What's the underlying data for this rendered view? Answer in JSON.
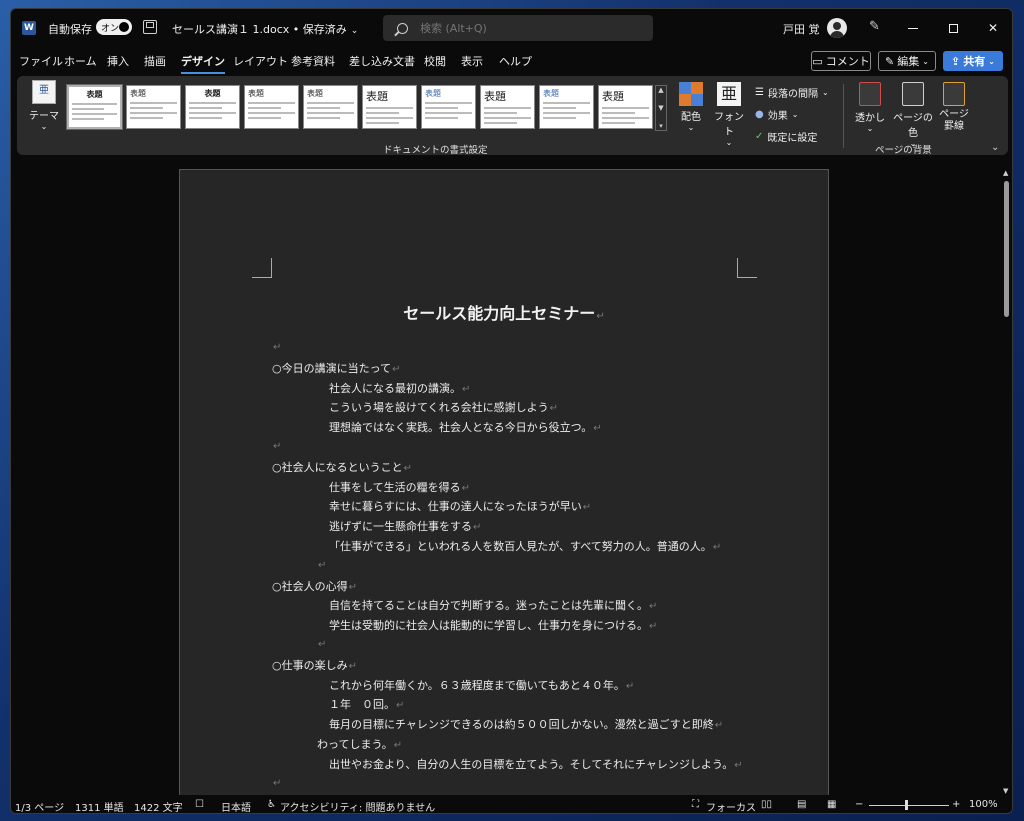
{
  "titlebar": {
    "app_letter": "W",
    "autosave_label": "自動保存",
    "toggle_label": "オン",
    "document_title": "セールス講演１ 1.docx • 保存済み",
    "search_placeholder": "検索 (Alt+Q)",
    "user_name": "戸田 覚"
  },
  "menu": {
    "tabs": [
      "ファイル",
      "ホーム",
      "挿入",
      "描画",
      "デザイン",
      "レイアウト",
      "参考資料",
      "差し込み文書",
      "校閲",
      "表示",
      "ヘルプ"
    ],
    "active_tab": "デザイン",
    "comment_label": "コメント",
    "edit_label": "編集",
    "share_label": "共有"
  },
  "ribbon": {
    "theme_label": "テーマ",
    "style_gallery": [
      {
        "heading": "表題",
        "variant": "center"
      },
      {
        "heading": "表題",
        "variant": "left"
      },
      {
        "heading": "表題",
        "variant": "center"
      },
      {
        "heading": "表題",
        "variant": "left"
      },
      {
        "heading": "表題",
        "variant": "left"
      },
      {
        "heading": "表題",
        "variant": "big"
      },
      {
        "heading": "表題",
        "variant": "blue"
      },
      {
        "heading": "表題",
        "variant": "big"
      },
      {
        "heading": "表題",
        "variant": "blue"
      },
      {
        "heading": "表題",
        "variant": "big"
      }
    ],
    "colors_label": "配色",
    "fonts_label": "フォント",
    "fonts_icon_glyph": "亜",
    "paragraph_spacing_label": "段落の間隔",
    "effects_label": "効果",
    "set_default_label": "既定に設定",
    "watermark_label": "透かし",
    "page_color_label": "ページの色",
    "page_borders_label": "ページ\n罫線",
    "group_document_formatting": "ドキュメントの書式設定",
    "group_page_background": "ページの背景"
  },
  "document": {
    "title": "セールス能力向上セミナー",
    "paragraph_mark": "↵",
    "lines": [
      {
        "kind": "empty",
        "text": ""
      },
      {
        "kind": "sec",
        "text": "○今日の講演に当たって"
      },
      {
        "kind": "ind",
        "text": "社会人になる最初の講演。"
      },
      {
        "kind": "ind",
        "text": "こういう場を設けてくれる会社に感謝しよう"
      },
      {
        "kind": "ind",
        "text": "理想論ではなく実践。社会人となる今日から役立つ。"
      },
      {
        "kind": "empty",
        "text": ""
      },
      {
        "kind": "sec",
        "text": "○社会人になるということ"
      },
      {
        "kind": "ind",
        "text": "仕事をして生活の糧を得る"
      },
      {
        "kind": "ind",
        "text": "幸せに暮らすには、仕事の達人になったほうが早い"
      },
      {
        "kind": "ind",
        "text": "逃げずに一生懸命仕事をする"
      },
      {
        "kind": "ind",
        "text": "「仕事ができる」といわれる人を数百人見たが、すべて努力の人。普通の人。"
      },
      {
        "kind": "mid",
        "text": ""
      },
      {
        "kind": "sec",
        "text": "○社会人の心得"
      },
      {
        "kind": "ind",
        "text": "自信を持てることは自分で判断する。迷ったことは先輩に聞く。"
      },
      {
        "kind": "ind",
        "text": "学生は受動的に社会人は能動的に学習し、仕事力を身につける。"
      },
      {
        "kind": "mid",
        "text": ""
      },
      {
        "kind": "sec",
        "text": "○仕事の楽しみ"
      },
      {
        "kind": "ind",
        "text": "これから何年働くか。６３歳程度まで働いてもあと４０年。"
      },
      {
        "kind": "ind",
        "text": "１年　０回。"
      },
      {
        "kind": "ind",
        "text": "毎月の目標にチャレンジできるのは約５００回しかない。漫然と過ごすと即終"
      },
      {
        "kind": "mid2",
        "text": "わってしまう。"
      },
      {
        "kind": "ind",
        "text": "出世やお金より、自分の人生の目標を立てよう。そしてそれにチャレンジしよう。"
      },
      {
        "kind": "empty",
        "text": ""
      }
    ]
  },
  "status": {
    "page": "1/3 ページ",
    "words": "1311 単語",
    "chars": "1422 文字",
    "language": "日本語",
    "accessibility": "アクセシビリティ: 問題ありません",
    "focus": "フォーカス",
    "zoom": "100%",
    "zoom_level_percent": 100
  }
}
